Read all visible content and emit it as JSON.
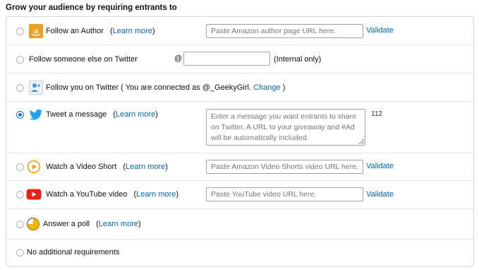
{
  "heading": "Grow your audience by requiring entrants to",
  "colors": {
    "link": "#0066c0",
    "radio_selected": "#1a73d9",
    "twitter_blue": "#1da1f2",
    "amazon_orange": "#f0a020",
    "video_orange": "#f39c12",
    "youtube_red": "#e62117",
    "poll_yellow": "#f5b400"
  },
  "options": {
    "follow_author": {
      "label": "Follow an Author",
      "learn_more": "Learn more",
      "input_placeholder": "Paste Amazon author page URL here.",
      "validate": "Validate",
      "icon": "amazon-icon",
      "selected": false
    },
    "follow_twitter": {
      "label": "Follow someone else on Twitter",
      "at_sign": "@",
      "input_value": "",
      "note": "(Internal only)",
      "selected": false
    },
    "follow_you": {
      "label_prefix": "Follow you on Twitter ( You are connected as @_GeekyGirl.",
      "change": "Change",
      "label_suffix": ")",
      "icon": "person-add-icon",
      "selected": false
    },
    "tweet": {
      "label": "Tweet a message",
      "learn_more": "Learn more",
      "textarea_placeholder": "Enter a message you want entrants to share on Twitter. A URL to your giveaway and #Ad will be automatically included.",
      "char_count": "112",
      "icon": "twitter-bird-icon",
      "selected": true
    },
    "video_short": {
      "label": "Watch a Video Short",
      "learn_more": "Learn more",
      "input_placeholder": "Paste Amazon Video Shorts video URL here.",
      "validate": "Validate",
      "icon": "play-circle-icon",
      "selected": false
    },
    "youtube": {
      "label": "Watch a YouTube video",
      "learn_more": "Learn more",
      "input_placeholder": "Paste YouTube video URL here.",
      "validate": "Validate",
      "icon": "youtube-icon",
      "selected": false
    },
    "poll": {
      "label": "Answer a poll",
      "learn_more": "Learn more",
      "icon": "pie-chart-icon",
      "selected": false
    },
    "none": {
      "label": "No additional requirements",
      "selected": false
    }
  }
}
